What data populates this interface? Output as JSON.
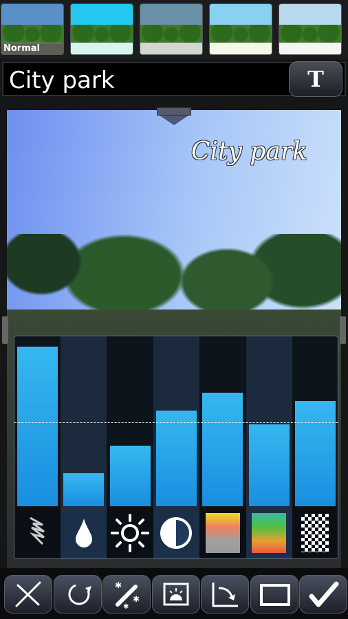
{
  "filters": [
    {
      "label": "Normal",
      "sky": "#5a90c8",
      "sand": "#8a9870"
    },
    {
      "label": "",
      "sky": "#22c8ee",
      "sand": "#d8f4ee"
    },
    {
      "label": "",
      "sky": "#6a90a8",
      "sand": "#d0d8d0"
    },
    {
      "label": "",
      "sky": "#8ad0f0",
      "sand": "#f4f8e8"
    },
    {
      "label": "",
      "sky": "#b8d8ee",
      "sand": "#f4f6f4"
    }
  ],
  "title_input": {
    "value": "City park"
  },
  "text_button": {
    "label": "T"
  },
  "photo": {
    "caption": "City park"
  },
  "adjustments": {
    "default_level": 0.51,
    "sliders": [
      {
        "name": "sharpen",
        "level": 0.97,
        "icon": "sharpen-icon"
      },
      {
        "name": "saturation",
        "level": 0.2,
        "icon": "droplet-icon"
      },
      {
        "name": "brightness",
        "level": 0.37,
        "icon": "sun-icon"
      },
      {
        "name": "contrast",
        "level": 0.58,
        "icon": "contrast-icon"
      },
      {
        "name": "warmth",
        "level": 0.69,
        "icon": "warm-gradient-icon"
      },
      {
        "name": "tint",
        "level": 0.5,
        "icon": "tint-gradient-icon"
      },
      {
        "name": "vignette",
        "level": 0.64,
        "icon": "checkerboard-icon"
      }
    ]
  },
  "toolbar": [
    "cancel-icon",
    "rotate-icon",
    "magic-wand-icon",
    "adjust-image-icon",
    "crop-curve-icon",
    "frame-icon",
    "confirm-icon"
  ],
  "colors": {
    "accent": "#2aa8ee",
    "panel": "#0c1118"
  }
}
